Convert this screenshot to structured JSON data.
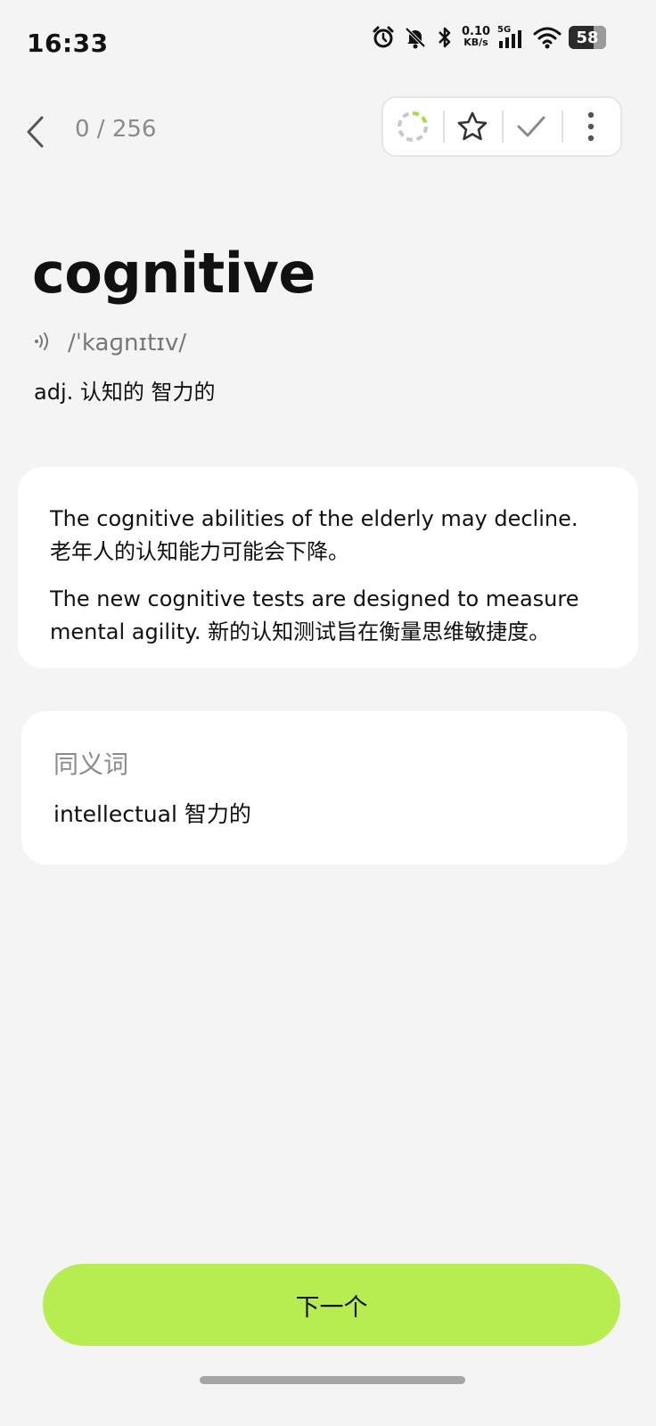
{
  "status_bar": {
    "time": "16:33",
    "net_speed_value": "0.10",
    "net_speed_unit": "KB/s",
    "network_type": "5G",
    "battery": "58"
  },
  "nav": {
    "progress": "0 / 256"
  },
  "word": {
    "headword": "cognitive",
    "phonetic": "/ˈkaɡnɪtɪv/",
    "definition": "adj. 认知的  智力的"
  },
  "examples": [
    {
      "text": "The cognitive abilities of the elderly may decline. 老年人的认知能力可能会下降。"
    },
    {
      "text": "The new cognitive tests are designed to measure mental agility.  新的认知测试旨在衡量思维敏捷度。"
    }
  ],
  "synonyms": {
    "title": "同义词",
    "items": [
      {
        "text": "intellectual 智力的"
      }
    ]
  },
  "footer": {
    "next_label": "下一个"
  },
  "colors": {
    "accent": "#b8ed52",
    "background": "#f4f4f4",
    "progress_ring_active": "#a6de4a"
  },
  "icons": {
    "toolbar": [
      "progress-ring-icon",
      "star-icon",
      "check-icon",
      "more-vertical-icon"
    ],
    "nav": [
      "chevron-left-icon"
    ],
    "pronunciation": [
      "speaker-icon"
    ]
  }
}
